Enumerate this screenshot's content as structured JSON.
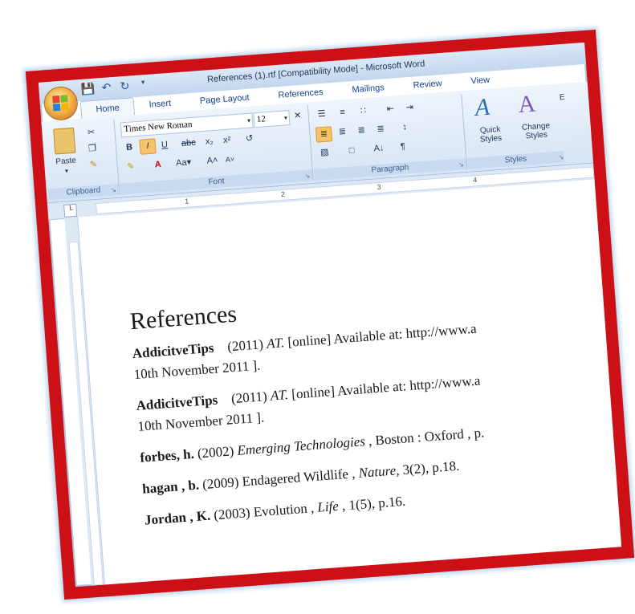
{
  "window": {
    "title": "References (1).rtf [Compatibility Mode] - Microsoft Word"
  },
  "quick_access": {
    "icons": [
      "save-icon",
      "undo-icon",
      "redo-icon",
      "customize-icon"
    ]
  },
  "tabs": [
    "Home",
    "Insert",
    "Page Layout",
    "References",
    "Mailings",
    "Review",
    "View"
  ],
  "ribbon": {
    "clipboard": {
      "paste_label": "Paste",
      "group_label": "Clipboard"
    },
    "font": {
      "font_name": "Times New Roman",
      "font_size": "12",
      "group_label": "Font"
    },
    "paragraph": {
      "group_label": "Paragraph"
    },
    "styles": {
      "quick_styles": "Quick Styles",
      "change_styles": "Change Styles",
      "group_label": "Styles"
    },
    "editing_partial": "E"
  },
  "document": {
    "heading": "References",
    "references": [
      {
        "author": "AddicitveTips",
        "year": "(2011)",
        "title": "AT.",
        "rest": "[online] Available at: http://www.a",
        "cont": "10th November 2011 ]."
      },
      {
        "author": "AddicitveTips",
        "year": "(2011)",
        "title": "AT.",
        "rest": "[online] Available at: http://www.a",
        "cont": "10th November 2011 ]."
      },
      {
        "author": "forbes, h.",
        "year": "(2002)",
        "title": "Emerging Technologies",
        "rest": ", Boston : Oxford , p.",
        "cont": ""
      },
      {
        "author": "hagan , b.",
        "year": "(2009)",
        "title_plain": "Endagered Wildlife ,",
        "journal": "Nature,",
        "rest": "3(2), p.18.",
        "cont": ""
      },
      {
        "author": "Jordan , K.",
        "year": "(2003)",
        "title_plain": "Evolution ,",
        "journal": "Life",
        "rest": ", 1(5), p.16.",
        "cont": ""
      }
    ]
  },
  "colors": {
    "frame": "#cc1016",
    "ribbon": "#d6e4f5",
    "accent": "#15428b"
  }
}
